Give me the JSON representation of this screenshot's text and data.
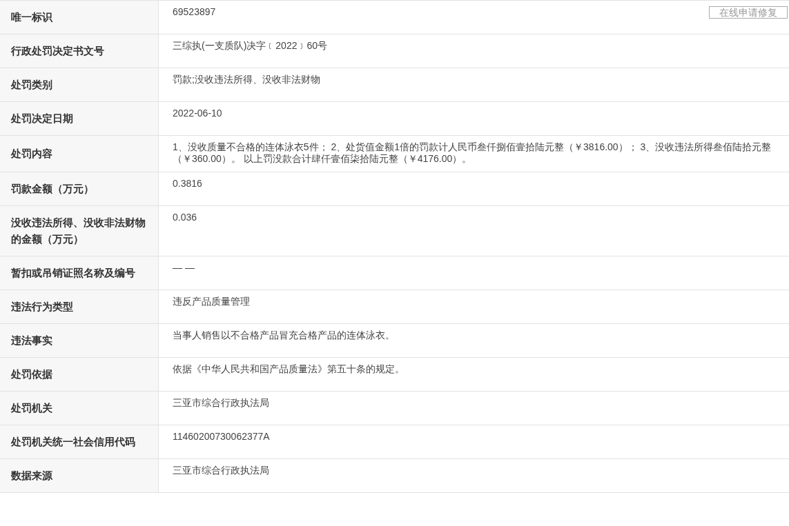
{
  "repair_button": "在线申请修复",
  "rows": [
    {
      "label": "唯一标识",
      "value": "69523897"
    },
    {
      "label": "行政处罚决定书文号",
      "value": "三综执(一支质队)决字﹝2022﹞60号"
    },
    {
      "label": "处罚类别",
      "value": "罚款;没收违法所得、没收非法财物"
    },
    {
      "label": "处罚决定日期",
      "value": "2022-06-10"
    },
    {
      "label": "处罚内容",
      "value": "1、没收质量不合格的连体泳衣5件； 2、处货值金额1倍的罚款计人民币叁仟捌佰壹拾陆元整（￥3816.00）； 3、没收违法所得叁佰陆拾元整（￥360.00）。 以上罚没款合计肆仟壹佰柒拾陆元整（￥4176.00）。"
    },
    {
      "label": "罚款金额（万元）",
      "value": "0.3816"
    },
    {
      "label": "没收违法所得、没收非法财物的金额（万元）",
      "value": "0.036"
    },
    {
      "label": "暂扣或吊销证照名称及编号",
      "value": "— —"
    },
    {
      "label": "违法行为类型",
      "value": "违反产品质量管理"
    },
    {
      "label": "违法事实",
      "value": "当事人销售以不合格产品冒充合格产品的连体泳衣。"
    },
    {
      "label": "处罚依据",
      "value": "依据《中华人民共和国产品质量法》第五十条的规定。"
    },
    {
      "label": "处罚机关",
      "value": "三亚市综合行政执法局"
    },
    {
      "label": "处罚机关统一社会信用代码",
      "value": "11460200730062377A"
    },
    {
      "label": "数据来源",
      "value": "三亚市综合行政执法局"
    }
  ]
}
